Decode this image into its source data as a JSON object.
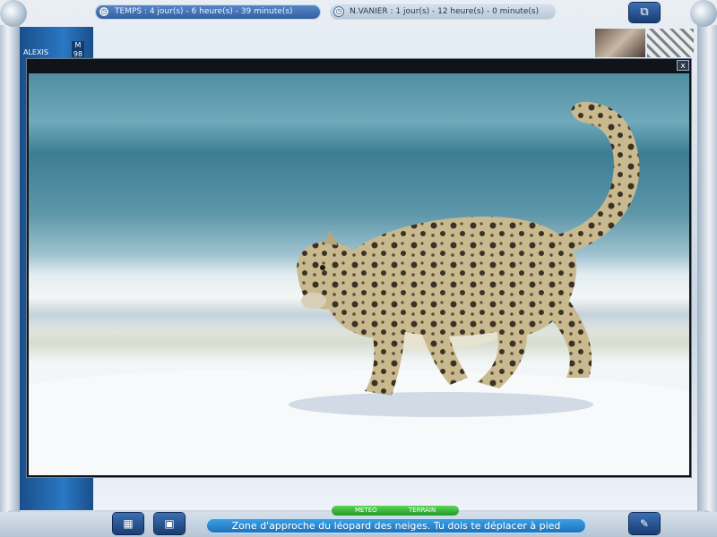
{
  "timers": {
    "time_label": "TEMPS : 4 jour(s) - 6 heure(s) - 39 minute(s)",
    "opponent_label": "N.VANIER : 1 jour(s) - 12 heure(s) - 0 minute(s)"
  },
  "player": {
    "name": "ALEXIS",
    "level_letter": "M",
    "level_value": "98"
  },
  "popup": {
    "close_label": "x"
  },
  "tabs": {
    "weather": "METEO",
    "terrain": "TERRAIN"
  },
  "status_message": "Zone d'approche du léopard des neiges. Tu dois te déplacer à pied",
  "icons": {
    "top_right": "window-toggle-icon",
    "bottom_left_1": "calendar-icon",
    "bottom_left_2": "save-icon",
    "bottom_right": "notebook-icon"
  },
  "colors": {
    "accent": "#2a78c4",
    "message_bar": "#1a6fb8",
    "tab_green": "#1e9a23"
  }
}
